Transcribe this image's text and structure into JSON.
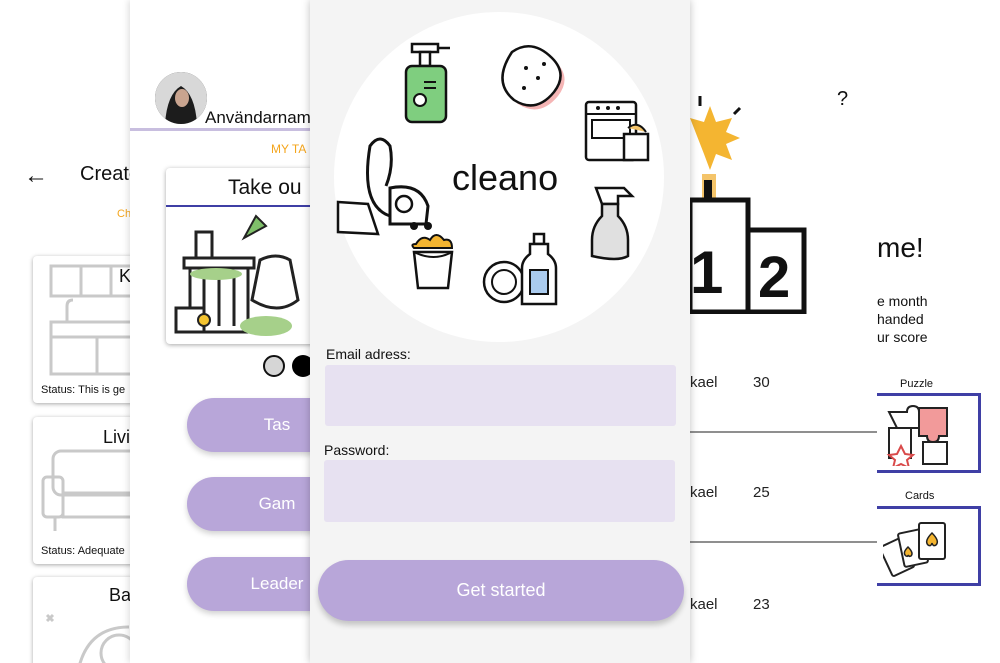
{
  "create_screen": {
    "title": "Create",
    "tab": "Ch",
    "cards": [
      {
        "title": "K",
        "status": "Status: This is ge"
      },
      {
        "title": "Livi",
        "status": "Status: Adequate"
      },
      {
        "title": "Ba",
        "status": ""
      }
    ]
  },
  "menu_screen": {
    "username": "Användarnam",
    "tab_label": "MY TA",
    "task_card_title": "Take ou",
    "buttons": [
      "Tas",
      "Gam",
      "Leader"
    ]
  },
  "login_screen": {
    "app_name": "cleano",
    "email_label": "Email adress:",
    "email_value": "",
    "password_label": "Password:",
    "password_value": "",
    "submit_label": "Get started"
  },
  "leaderboard_screen": {
    "help_label": "?",
    "podium": [
      "1",
      "2"
    ],
    "rows": [
      {
        "name": "kael",
        "score": "30"
      },
      {
        "name": "kael",
        "score": "25"
      },
      {
        "name": "kael",
        "score": "23"
      }
    ]
  },
  "games_screen": {
    "heading": "me!",
    "description_lines": [
      "e month",
      "handed",
      "ur score"
    ],
    "games": [
      {
        "label": "Puzzle",
        "icon": "puzzle-icon"
      },
      {
        "label": "Cards",
        "icon": "cards-icon"
      }
    ]
  },
  "colors": {
    "accent_purple": "#b8a6d9",
    "field_bg": "#e7e1f1",
    "tab_orange": "#f4a51c",
    "card_border_blue": "#3f3fa5"
  }
}
